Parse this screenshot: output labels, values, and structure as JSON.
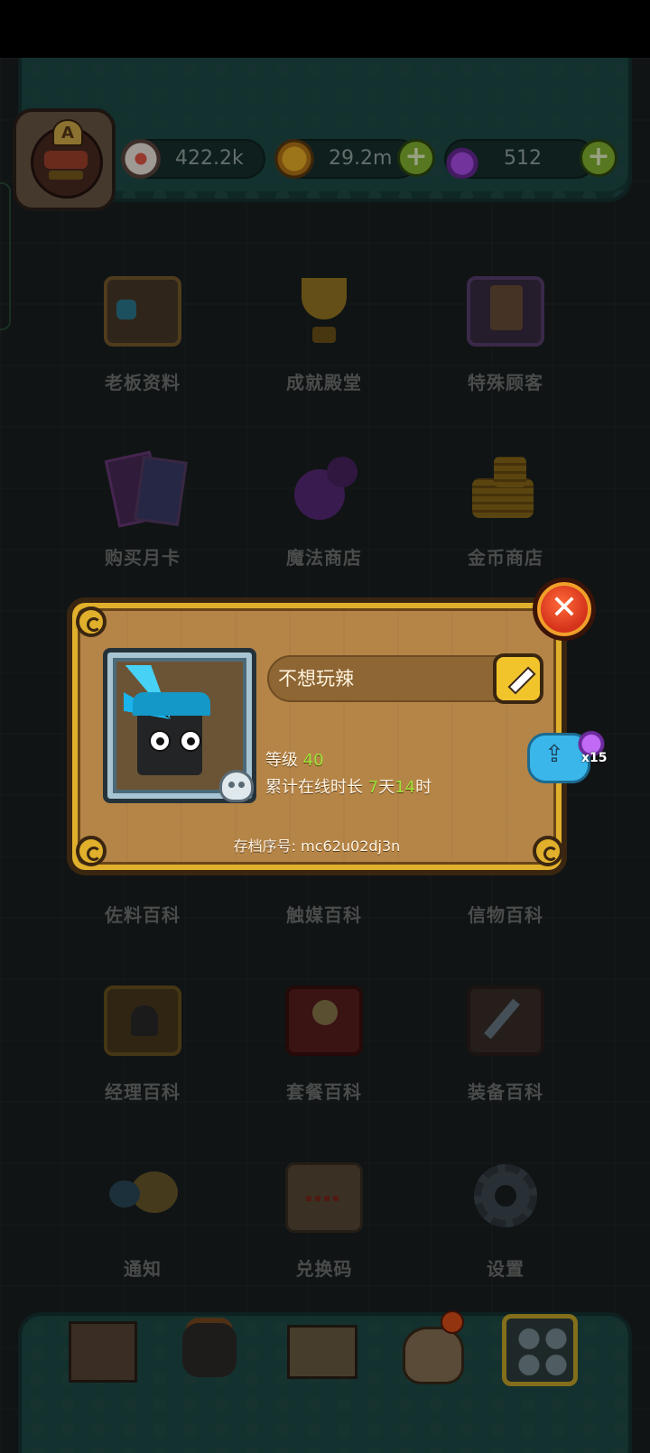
{
  "resources": {
    "eyes": "422.2k",
    "coins": "29.2m",
    "potions": "512"
  },
  "profile": {
    "avatar_letter": "A"
  },
  "menu": [
    {
      "label": "老板资料",
      "icon": "boss-profile-icon"
    },
    {
      "label": "成就殿堂",
      "icon": "trophy-icon"
    },
    {
      "label": "特殊顾客",
      "icon": "special-customer-icon"
    },
    {
      "label": "购买月卡",
      "icon": "monthly-card-icon"
    },
    {
      "label": "魔法商店",
      "icon": "magic-potion-icon"
    },
    {
      "label": "金币商店",
      "icon": "gold-coins-icon"
    },
    {
      "label": "佐料百科",
      "icon": "seasoning-book-icon"
    },
    {
      "label": "触媒百科",
      "icon": "catalyst-book-icon"
    },
    {
      "label": "信物百科",
      "icon": "token-book-icon"
    },
    {
      "label": "经理百科",
      "icon": "manager-book-icon"
    },
    {
      "label": "套餐百科",
      "icon": "meal-book-icon"
    },
    {
      "label": "装备百科",
      "icon": "equipment-book-icon"
    },
    {
      "label": "通知",
      "icon": "horn-icon"
    },
    {
      "label": "兑换码",
      "icon": "scroll-icon"
    },
    {
      "label": "设置",
      "icon": "gear-icon"
    }
  ],
  "player_card": {
    "name": "不想玩辣",
    "level_label": "等级",
    "level": "40",
    "online_label": "累计在线时长",
    "days": "7",
    "days_unit": "天",
    "hours": "14",
    "hours_unit": "时",
    "save_id": "存档序号: mc62u02dj3n",
    "close_symbol": "✕",
    "share_reward_count": "x15"
  },
  "colors": {
    "modal_wood": "#b58547",
    "modal_border": "#e0b02c",
    "level_green": "#9fe33a",
    "topbar_teal": "#1e4c47"
  }
}
